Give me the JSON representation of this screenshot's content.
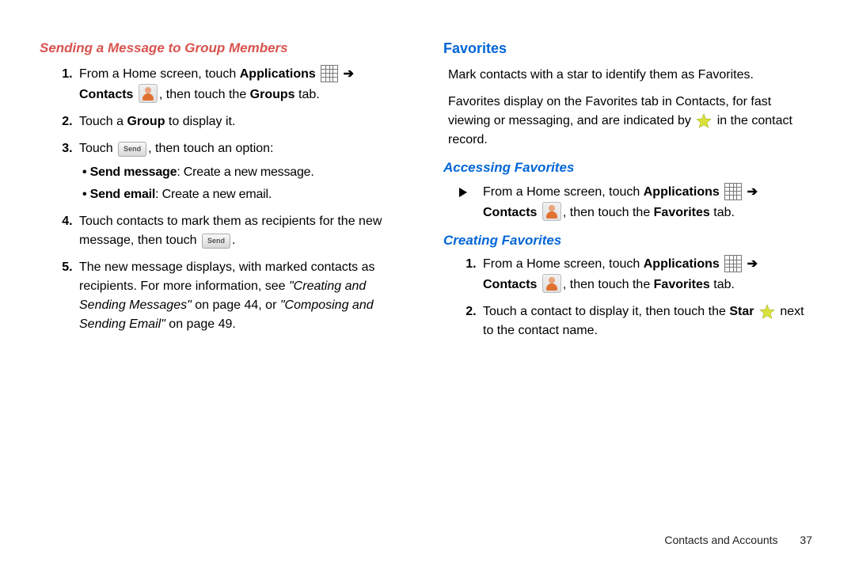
{
  "left": {
    "heading": "Sending a Message to Group Members",
    "li1_a": "From a Home screen, touch ",
    "li1_apps": "Applications",
    "li1_arrow": "➔",
    "li1_contacts": "Contacts",
    "li1_b": ", then touch the ",
    "li1_groups": "Groups",
    "li1_tab": " tab.",
    "li2_a": "Touch a ",
    "li2_group": "Group",
    "li2_b": " to display it.",
    "li3_a": "Touch ",
    "li3_send": "Send",
    "li3_b": ", then touch an option:",
    "bul1_b": "Send message",
    "bul1_r": ": Create a new message.",
    "bul2_b": "Send email",
    "bul2_r": ": Create a new email.",
    "li4_a": "Touch contacts to mark them as recipients for the new message, then touch ",
    "li4_send": "Send",
    "li4_b": ".",
    "li5_a": "The new message displays, with marked contacts as recipients. For more information, see ",
    "li5_ref1": "\"Creating and Sending Messages\"",
    "li5_mid": " on page 44, or ",
    "li5_ref2": "\"Composing and Sending Email\"",
    "li5_end": " on page 49."
  },
  "right": {
    "h1": "Favorites",
    "p1": "Mark contacts with a star to identify them as Favorites.",
    "p2_a": "Favorites display on the Favorites tab in Contacts, for fast viewing or messaging, and are indicated by ",
    "p2_b": " in the contact record.",
    "h2": "Accessing Favorites",
    "af_a": "From a Home screen, touch ",
    "af_apps": "Applications",
    "af_arrow": "➔",
    "af_contacts": "Contacts",
    "af_b": ", then touch the ",
    "af_fav": "Favorites",
    "af_tab": " tab.",
    "h3": "Creating Favorites",
    "cf1_a": "From a Home screen, touch ",
    "cf1_apps": "Applications",
    "cf1_arrow": "➔",
    "cf1_contacts": "Contacts",
    "cf1_b": ", then touch the ",
    "cf1_fav": "Favorites",
    "cf1_tab": " tab.",
    "cf2_a": "Touch a contact to display it, then touch the ",
    "cf2_star": "Star",
    "cf2_b": " next to the contact name."
  },
  "footer": {
    "section": "Contacts and Accounts",
    "page": "37"
  }
}
